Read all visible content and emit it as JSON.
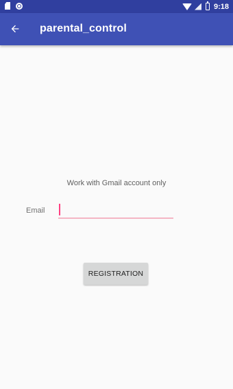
{
  "status_bar": {
    "time": "9:18",
    "left_icons": [
      "sd-card-icon",
      "sync-icon"
    ],
    "right_icons": [
      "wifi-icon",
      "signal-icon",
      "battery-icon"
    ],
    "color": "#303f9f"
  },
  "app_bar": {
    "title": "parental_control",
    "back_icon": "arrow-back-icon",
    "color": "#3f51b5"
  },
  "form": {
    "notice": "Work with Gmail account only",
    "email_label": "Email",
    "email_value": "",
    "accent_color": "#ff4081"
  },
  "actions": {
    "registration_label": "REGISTRATION"
  }
}
